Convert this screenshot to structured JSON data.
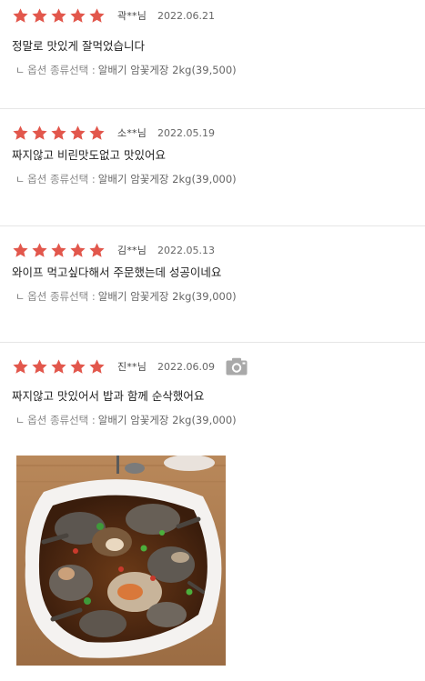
{
  "reviews": [
    {
      "user": "곽**님",
      "date": "2022.06.21",
      "text": "정말로 맛있게 잘먹었습니다",
      "opt_mark": "ㄴ",
      "opt_label": "옵션 종류선택 :",
      "opt_value": "알배기 암꽃게장 2kg(39,500)",
      "rating": 5,
      "has_photo": false
    },
    {
      "user": "소**님",
      "date": "2022.05.19",
      "text": "짜지않고 비린맛도없고 맛있어요",
      "opt_mark": "ㄴ",
      "opt_label": "옵션 종류선택 :",
      "opt_value": "알배기 암꽃게장 2kg(39,000)",
      "rating": 5,
      "has_photo": false
    },
    {
      "user": "김**님",
      "date": "2022.05.13",
      "text": "와이프 먹고싶다해서 주문했는데 성공이네요",
      "opt_mark": "ㄴ",
      "opt_label": "옵션 종류선택 :",
      "opt_value": "알배기 암꽃게장 2kg(39,000)",
      "rating": 5,
      "has_photo": false
    },
    {
      "user": "진**님",
      "date": "2022.06.09",
      "text": "짜지않고 맛있어서 밥과 함께 순삭했어요",
      "opt_mark": "ㄴ",
      "opt_label": "옵션 종류선택 :",
      "opt_value": "알배기 암꽃게장 2kg(39,000)",
      "rating": 5,
      "has_photo": true
    }
  ],
  "icons": {
    "star": "star-icon",
    "photo": "camera-icon"
  },
  "colors": {
    "star": "#e2574c",
    "camera": "#a9a9a9"
  }
}
